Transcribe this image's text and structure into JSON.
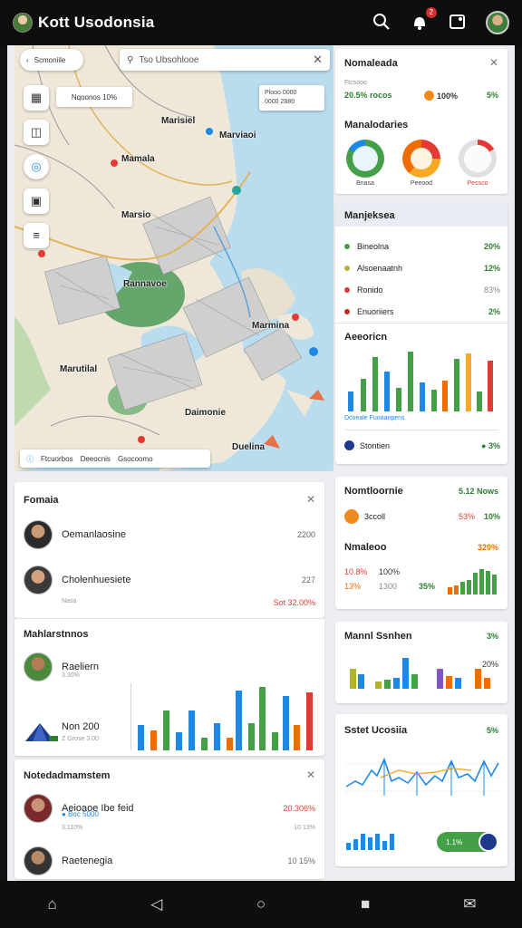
{
  "app": {
    "title": "Kott Usodonsia"
  },
  "topbar": {
    "search_icon": "search-icon",
    "notif_badge": "2"
  },
  "map": {
    "search_placeholder": "Tso Ubsohlooe",
    "back_label": "Scmoniile",
    "chip_label": "Nqoonos 10%",
    "legend_lines": [
      "Plooo 0000",
      "0000 2880"
    ],
    "labels": [
      "Marisiel",
      "Marviaoi",
      "Mamala",
      "Marsio",
      "Rannavoe",
      "Marmina",
      "Marutilal",
      "Daimonie",
      "Duelina"
    ],
    "bottom_items": [
      "Ftcuorbos",
      "Deeocnis",
      "Gsocoomo"
    ]
  },
  "right": {
    "card1": {
      "title": "Nomaleada",
      "stats_label": "Ftcsooo",
      "stat1": "20.5% rocos",
      "stat2": "100%",
      "stat3": "5%",
      "sub_title": "Manalodaries",
      "donuts": [
        "Bnasa",
        "Peeood",
        "Pessco"
      ]
    },
    "card2": {
      "title": "Manjeksea",
      "rows": [
        {
          "label": "Bineolna",
          "value": "20%",
          "color": "#43a047"
        },
        {
          "label": "Alsoenaatnh",
          "value": "12%",
          "color": "#afb42b"
        },
        {
          "label": "Ronido",
          "value": "83%",
          "color": "#e53935"
        },
        {
          "label": "Enuoriiers",
          "value": "2%",
          "color": "#c62828"
        }
      ],
      "chart_title": "Aeeoricn",
      "chart_caption": "Dcoeale Fuoaanpens",
      "footer_label": "Stontien",
      "footer_value": "3%"
    },
    "card3": {
      "title": "Nomtloornie",
      "title_value": "5.12 Nows",
      "row_label": "3ccoll",
      "row_val1": "53%",
      "row_val2": "10%",
      "sub_title": "Nmaleoo",
      "sub_value": "320%",
      "m1": "10.8%",
      "m2": "100%",
      "m3": "13%",
      "m4": "1300",
      "m5": "35%"
    },
    "card4": {
      "title": "Mannl Ssnhen",
      "value": "3%",
      "value2": "20%"
    },
    "card5": {
      "title": "Sstet Ucosiia",
      "value": "5%",
      "toggle_label": "1.1%"
    }
  },
  "left": {
    "card1": {
      "title": "Fomaia",
      "people": [
        {
          "name": "Oemanlaosine",
          "value": "2200"
        },
        {
          "name": "Cholenhuesiete",
          "value": "227",
          "sub": "Nasa",
          "sub_value": "Sot 32.00%"
        }
      ]
    },
    "card2": {
      "title": "Mahlarstnnos",
      "person_name": "Raeliern",
      "person_sub": "3.30%",
      "item_name": "Non 200",
      "item_sub": "Z Grose 3.00"
    },
    "card3": {
      "title": "Notedadmamstem",
      "people": [
        {
          "name": "Aeioaoe Ibe feid",
          "sub": "Boc 5000",
          "sub2": "3.110%",
          "value": "20.306%",
          "value2": "10 13%"
        },
        {
          "name": "Raetenegia",
          "value": "10 15%"
        }
      ]
    }
  }
}
